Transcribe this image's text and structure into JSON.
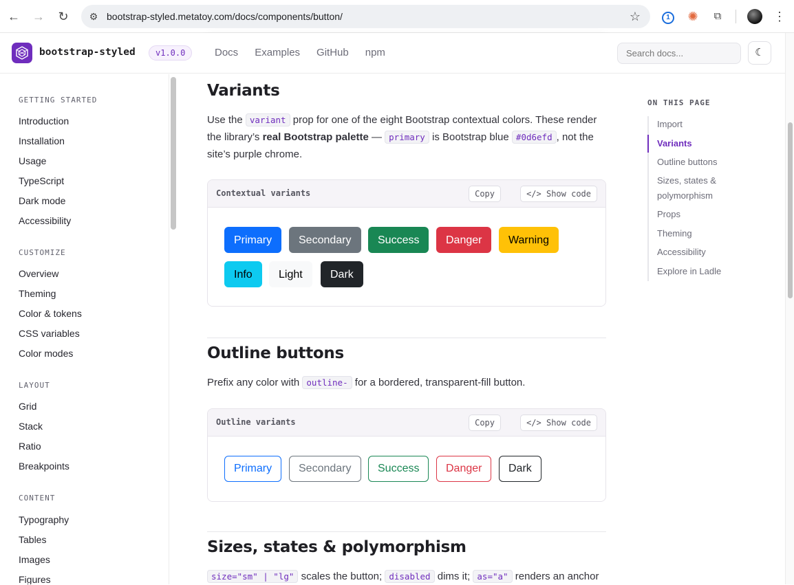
{
  "browser": {
    "url": "bootstrap-styled.metatoy.com/docs/components/button/"
  },
  "header": {
    "brand": "bootstrap-styled",
    "version": "v1.0.0",
    "nav": [
      "Docs",
      "Examples",
      "GitHub",
      "npm"
    ],
    "search_placeholder": "Search docs..."
  },
  "sidebar": {
    "groups": [
      {
        "title": "GETTING STARTED",
        "items": [
          "Introduction",
          "Installation",
          "Usage",
          "TypeScript",
          "Dark mode",
          "Accessibility"
        ]
      },
      {
        "title": "CUSTOMIZE",
        "items": [
          "Overview",
          "Theming",
          "Color & tokens",
          "CSS variables",
          "Color modes"
        ]
      },
      {
        "title": "LAYOUT",
        "items": [
          "Grid",
          "Stack",
          "Ratio",
          "Breakpoints"
        ]
      },
      {
        "title": "CONTENT",
        "items": [
          "Typography",
          "Tables",
          "Images",
          "Figures"
        ]
      }
    ]
  },
  "sections": {
    "variants": {
      "heading": "Variants",
      "p1_a": "Use the ",
      "p1_code1": "variant",
      "p1_b": " prop for one of the eight Bootstrap contextual colors. These render the library’s ",
      "p1_strong": "real Bootstrap palette",
      "p1_c": " — ",
      "p1_code2": "primary",
      "p1_d": " is Bootstrap blue ",
      "p1_code3": "#0d6efd",
      "p1_e": ", not the site’s purple chrome.",
      "card_title": "Contextual variants",
      "copy": "Copy",
      "show_code": "</> Show code",
      "buttons": [
        "Primary",
        "Secondary",
        "Success",
        "Danger",
        "Warning",
        "Info",
        "Light",
        "Dark"
      ]
    },
    "outline": {
      "heading": "Outline buttons",
      "p_a": "Prefix any color with ",
      "p_code": "outline-",
      "p_b": " for a bordered, transparent-fill button.",
      "card_title": "Outline variants",
      "copy": "Copy",
      "show_code": "</> Show code",
      "buttons": [
        "Primary",
        "Secondary",
        "Success",
        "Danger",
        "Dark"
      ]
    },
    "sizes": {
      "heading": "Sizes, states & polymorphism",
      "p_code1": "size=\"sm\" | \"lg\"",
      "p_a": " scales the button; ",
      "p_code2": "disabled",
      "p_b": " dims it; ",
      "p_code3": "as=\"a\"",
      "p_c": " renders an anchor"
    }
  },
  "toc": {
    "title": "ON THIS PAGE",
    "items": [
      "Import",
      "Variants",
      "Outline buttons",
      "Sizes, states &",
      "polymorphism",
      "Props",
      "Theming",
      "Accessibility",
      "Explore in Ladle"
    ],
    "active": "Variants"
  },
  "colors": {
    "accent": "#6f2dbd",
    "primary": "#0d6efd",
    "secondary": "#6c757d",
    "success": "#198754",
    "danger": "#dc3545",
    "warning": "#ffc107",
    "info": "#0dcaf0",
    "light": "#f8f9fa",
    "dark": "#212529"
  }
}
